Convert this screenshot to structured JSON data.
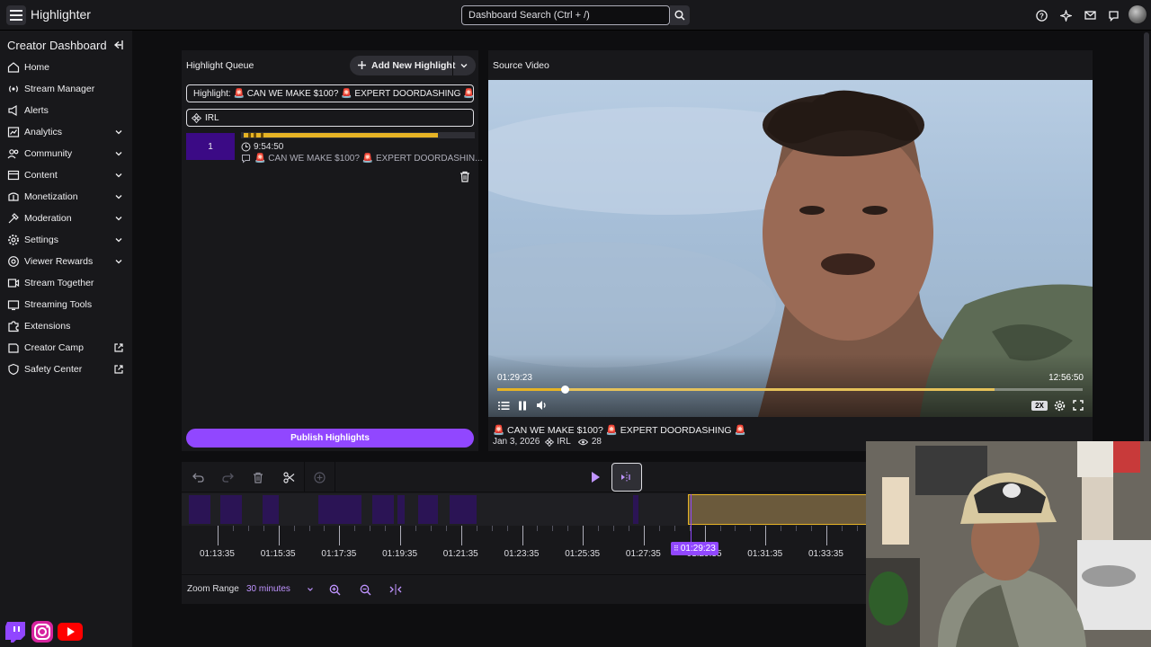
{
  "topbar": {
    "app_title": "Highlighter",
    "search_placeholder": "Dashboard Search (Ctrl + /)",
    "icons": [
      "help-icon",
      "sparkle-icon",
      "inbox-icon",
      "whispers-icon",
      "avatar"
    ]
  },
  "sidebar": {
    "header": "Creator Dashboard",
    "items": [
      {
        "label": "Home",
        "icon": "home-icon",
        "expandable": false
      },
      {
        "label": "Stream Manager",
        "icon": "stream-manager-icon",
        "expandable": false
      },
      {
        "label": "Alerts",
        "icon": "alerts-icon",
        "expandable": false
      },
      {
        "label": "Analytics",
        "icon": "analytics-icon",
        "expandable": true
      },
      {
        "label": "Community",
        "icon": "community-icon",
        "expandable": true
      },
      {
        "label": "Content",
        "icon": "content-icon",
        "expandable": true
      },
      {
        "label": "Monetization",
        "icon": "monetization-icon",
        "expandable": true
      },
      {
        "label": "Moderation",
        "icon": "moderation-icon",
        "expandable": true
      },
      {
        "label": "Settings",
        "icon": "settings-icon",
        "expandable": true
      },
      {
        "label": "Viewer Rewards",
        "icon": "viewer-rewards-icon",
        "expandable": true
      },
      {
        "label": "Stream Together",
        "icon": "stream-together-icon",
        "expandable": false
      },
      {
        "label": "Streaming Tools",
        "icon": "streaming-tools-icon",
        "expandable": false
      },
      {
        "label": "Extensions",
        "icon": "extensions-icon",
        "expandable": false
      },
      {
        "label": "Creator Camp",
        "icon": "creator-camp-icon",
        "external": true
      },
      {
        "label": "Safety Center",
        "icon": "safety-center-icon",
        "external": true
      }
    ]
  },
  "queue": {
    "title": "Highlight Queue",
    "add_button": "Add New Highlight",
    "highlight_title": "Highlight: 🚨 CAN WE MAKE $100? 🚨 EXPERT DOORDASHING 🚨",
    "category": "IRL",
    "clips": [
      {
        "number": "1",
        "duration": "9:54:50",
        "title": "🚨 CAN WE MAKE $100? 🚨 EXPERT DOORDASHIN..."
      }
    ],
    "publish_button": "Publish Highlights"
  },
  "video": {
    "title": "Source Video",
    "current_time": "01:29:23",
    "duration": "12:56:50",
    "progress": 0.115,
    "speed": "2X",
    "caption": "🚨 CAN WE MAKE $100? 🚨 EXPERT DOORDASHING 🚨",
    "date": "Jan 3, 2026",
    "category": "IRL",
    "views": "28"
  },
  "timeline": {
    "ticks": [
      "01:13:35",
      "01:15:35",
      "01:17:35",
      "01:19:35",
      "01:21:35",
      "01:23:35",
      "01:25:35",
      "01:27:35",
      "01:29:35",
      "01:31:35",
      "01:33:35"
    ],
    "playhead": "01:29:23"
  },
  "zoom": {
    "label": "Zoom Range",
    "value": "30 minutes"
  },
  "colors": {
    "accent": "#9147ff",
    "highlight": "#e6b325",
    "panel": "#18181b",
    "background": "#0e0e10"
  }
}
